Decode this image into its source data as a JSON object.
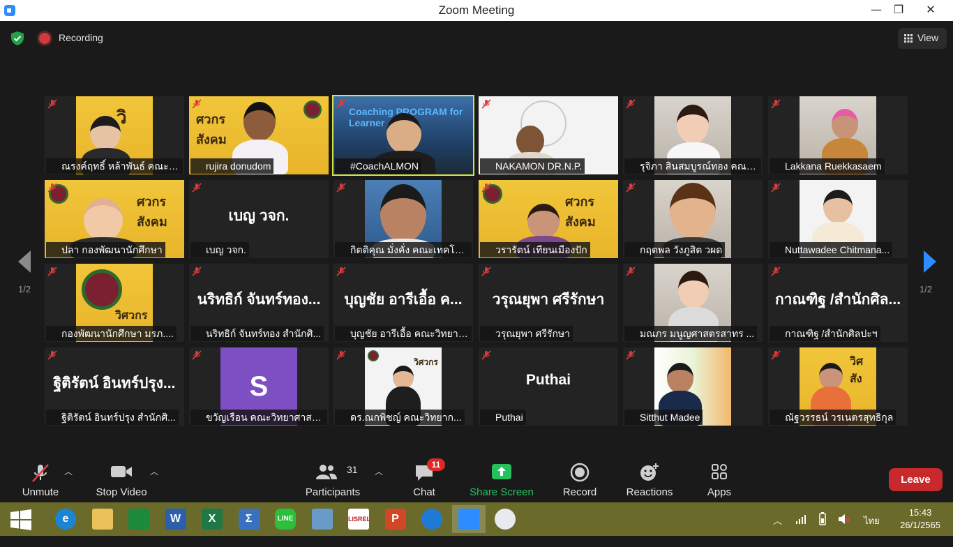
{
  "window": {
    "title": "Zoom Meeting",
    "minimize": "—",
    "maximize": "❐",
    "close": "✕"
  },
  "topbar": {
    "recording_label": "Recording",
    "view_label": "View",
    "shield_color": "#23a14a",
    "recording_color": "#d0393e"
  },
  "gallery": {
    "page_left": "1/2",
    "page_right": "1/2",
    "tiles": [
      {
        "name": "ณรงค์ฤทธิ์ หล้าพันธ์ คณะว...",
        "display": ""
      },
      {
        "name": "rujira donudom",
        "display": ""
      },
      {
        "name": "#CoachALMON",
        "display": "",
        "active": true,
        "video_text": "Coaching PROGRAM for Learner"
      },
      {
        "name": "NAKAMON DR.N.P.",
        "display": ""
      },
      {
        "name": "รุจิภา สินสมบูรณ์ทอง คณะ...",
        "display": ""
      },
      {
        "name": "Lakkana Ruekkasaem",
        "display": ""
      },
      {
        "name": "ปลา กองพัฒนานักศึกษา",
        "display": ""
      },
      {
        "name": "เบญ วจก.",
        "display": "เบญ วจก."
      },
      {
        "name": "กิตติคุณ มั่งคั่ง คณะเทคโนโ...",
        "display": ""
      },
      {
        "name": "วรารัตน์ เทียนเมืองปัก",
        "display": ""
      },
      {
        "name": "กฤตพล วังภูสิต วผด",
        "display": ""
      },
      {
        "name": "Nuttawadee Chitmana...",
        "display": ""
      },
      {
        "name": "กองพัฒนานักศึกษา มรภ....",
        "display": ""
      },
      {
        "name": "นริทธิก์ จันทร์ทอง สำนักศิ...",
        "display": "นริทธิก์ จันทร์ทอง..."
      },
      {
        "name": "บุญชัย อารีเอื้อ คณะวิทยาศ...",
        "display": "บุญชัย อารีเอื้อ ค..."
      },
      {
        "name": "วรุณยุพา ศรีรักษา",
        "display": "วรุณยุพา ศรีรักษา"
      },
      {
        "name": "มณภร มนูญศาสตรสาทร ...",
        "display": ""
      },
      {
        "name": "กาณฑิฐ /สำนักศิลปะฯ",
        "display": "กาณฑิฐ /สำนักศิล..."
      },
      {
        "name": "ฐิติรัตน์ อินทร์ปรุง สำนักศิ...",
        "display": "ฐิติรัตน์ อินทร์ปรุง..."
      },
      {
        "name": "ขวัญเรือน คณะวิทยาศาสต...",
        "display": "",
        "avatar_letter": "S"
      },
      {
        "name": "ดร.ณกพิชญ์ คณะวิทยาก...",
        "display": ""
      },
      {
        "name": "Puthai",
        "display": "Puthai"
      },
      {
        "name": "Sitthut Madee",
        "display": ""
      },
      {
        "name": "ณัฐวรรธน์ วรเนตรสุทธิกุล",
        "display": ""
      }
    ]
  },
  "toolbar": {
    "unmute": "Unmute",
    "stop_video": "Stop Video",
    "participants": "Participants",
    "participants_count": "31",
    "chat": "Chat",
    "chat_badge": "11",
    "share_screen": "Share Screen",
    "share_color": "#25c15c",
    "record": "Record",
    "reactions": "Reactions",
    "apps": "Apps",
    "leave": "Leave"
  },
  "taskbar": {
    "apps": [
      {
        "icon": "internet-explorer-icon",
        "label": "e"
      },
      {
        "icon": "file-explorer-icon",
        "label": ""
      },
      {
        "icon": "store-icon",
        "label": ""
      },
      {
        "icon": "word-icon",
        "label": "W"
      },
      {
        "icon": "excel-icon",
        "label": "X"
      },
      {
        "icon": "calculator-icon",
        "label": "Σ"
      },
      {
        "icon": "line-icon",
        "label": "LINE"
      },
      {
        "icon": "paint-icon",
        "label": ""
      },
      {
        "icon": "lisrel-icon",
        "label": "LISREL"
      },
      {
        "icon": "powerpoint-icon",
        "label": "P"
      },
      {
        "icon": "edge-icon",
        "label": ""
      },
      {
        "icon": "zoom-icon",
        "label": ""
      },
      {
        "icon": "chrome-icon",
        "label": ""
      }
    ],
    "language": "ไทย",
    "time": "15:43",
    "date": "26/1/2565"
  }
}
